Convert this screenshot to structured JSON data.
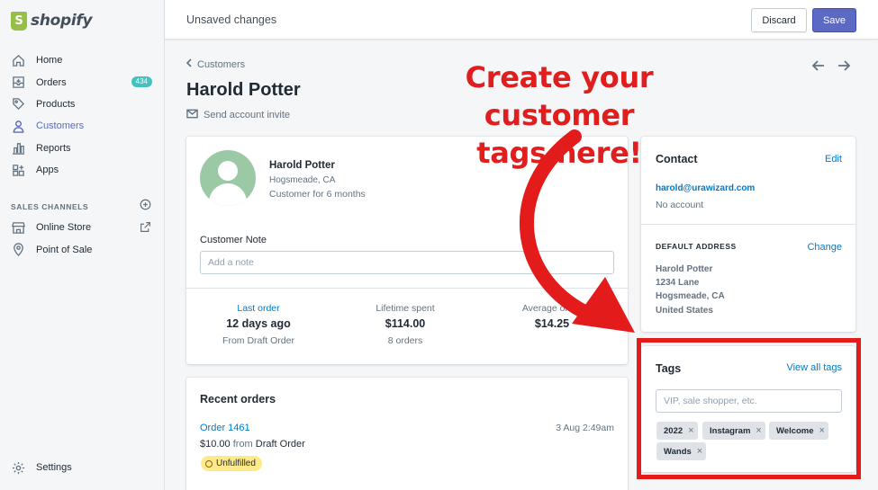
{
  "brand": {
    "name": "shopify"
  },
  "topbar": {
    "title": "Unsaved changes",
    "discard_label": "Discard",
    "save_label": "Save"
  },
  "sidebar": {
    "items": [
      {
        "label": "Home",
        "icon": "home-icon"
      },
      {
        "label": "Orders",
        "icon": "orders-icon",
        "badge": "434"
      },
      {
        "label": "Products",
        "icon": "tag-icon"
      },
      {
        "label": "Customers",
        "icon": "person-icon",
        "active": true
      },
      {
        "label": "Reports",
        "icon": "bar-chart-icon"
      },
      {
        "label": "Apps",
        "icon": "apps-icon"
      }
    ],
    "sales_channels_heading": "SALES CHANNELS",
    "sales_channels": [
      {
        "label": "Online Store",
        "icon": "store-icon"
      },
      {
        "label": "Point of Sale",
        "icon": "location-icon"
      }
    ],
    "settings_label": "Settings"
  },
  "page": {
    "breadcrumb": "Customers",
    "title": "Harold Potter",
    "send_invite": "Send account invite"
  },
  "customer": {
    "name": "Harold Potter",
    "location": "Hogsmeade, CA",
    "since": "Customer for 6 months",
    "note_label": "Customer Note",
    "note_placeholder": "Add a note",
    "stats": [
      {
        "label": "Last order",
        "value": "12 days ago",
        "sub": "From Draft Order"
      },
      {
        "label": "Lifetime spent",
        "value": "$114.00",
        "sub": "8 orders"
      },
      {
        "label": "Average order",
        "value": "$14.25",
        "sub": ""
      }
    ]
  },
  "recent_orders": {
    "title": "Recent orders",
    "order_number": "Order 1461",
    "date": "3 Aug 2:49am",
    "amount": "$10.00",
    "from_word": "from",
    "source": "Draft Order",
    "status": "Unfulfilled"
  },
  "contact": {
    "title": "Contact",
    "edit_label": "Edit",
    "email": "harold@urawizard.com",
    "account": "No account",
    "address_heading": "DEFAULT ADDRESS",
    "change_label": "Change",
    "address_lines": [
      "Harold Potter",
      "1234 Lane",
      "Hogsmeade, CA",
      "United States"
    ]
  },
  "tags": {
    "title": "Tags",
    "view_all_label": "View all tags",
    "input_placeholder": "VIP, sale shopper, etc.",
    "items": [
      "2022",
      "Instagram",
      "Welcome",
      "Wands"
    ]
  },
  "annotation": {
    "line1": "Create your customer",
    "line2": "tags here!",
    "color": "#e01e1e"
  },
  "colors": {
    "accent": "#5c6ac4",
    "link": "#007ace",
    "highlight": "#e31b1b"
  }
}
